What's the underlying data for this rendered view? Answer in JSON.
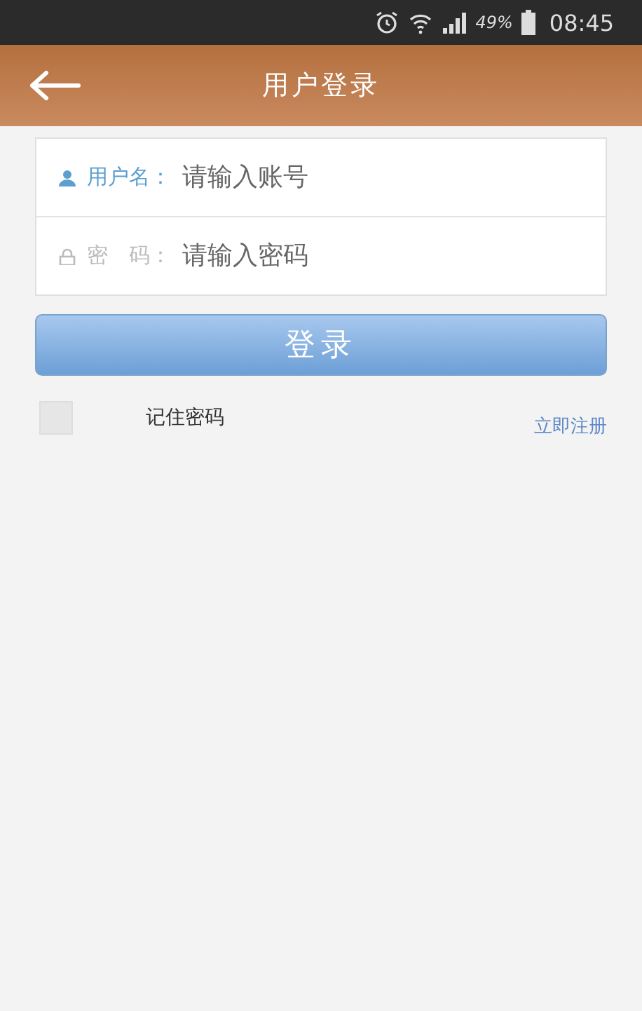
{
  "status_bar": {
    "battery": "49%",
    "time": "08:45"
  },
  "header": {
    "title": "用户登录"
  },
  "fields": [
    {
      "kind": "user",
      "label": "用户名：",
      "placeholder": "请输入账号",
      "focused": true
    },
    {
      "kind": "password",
      "label": "密　码：",
      "placeholder": "请输入密码",
      "focused": false
    }
  ],
  "login_button": "登录",
  "remember": {
    "label": "记住密码",
    "checked": false
  },
  "register_link": "立即注册"
}
